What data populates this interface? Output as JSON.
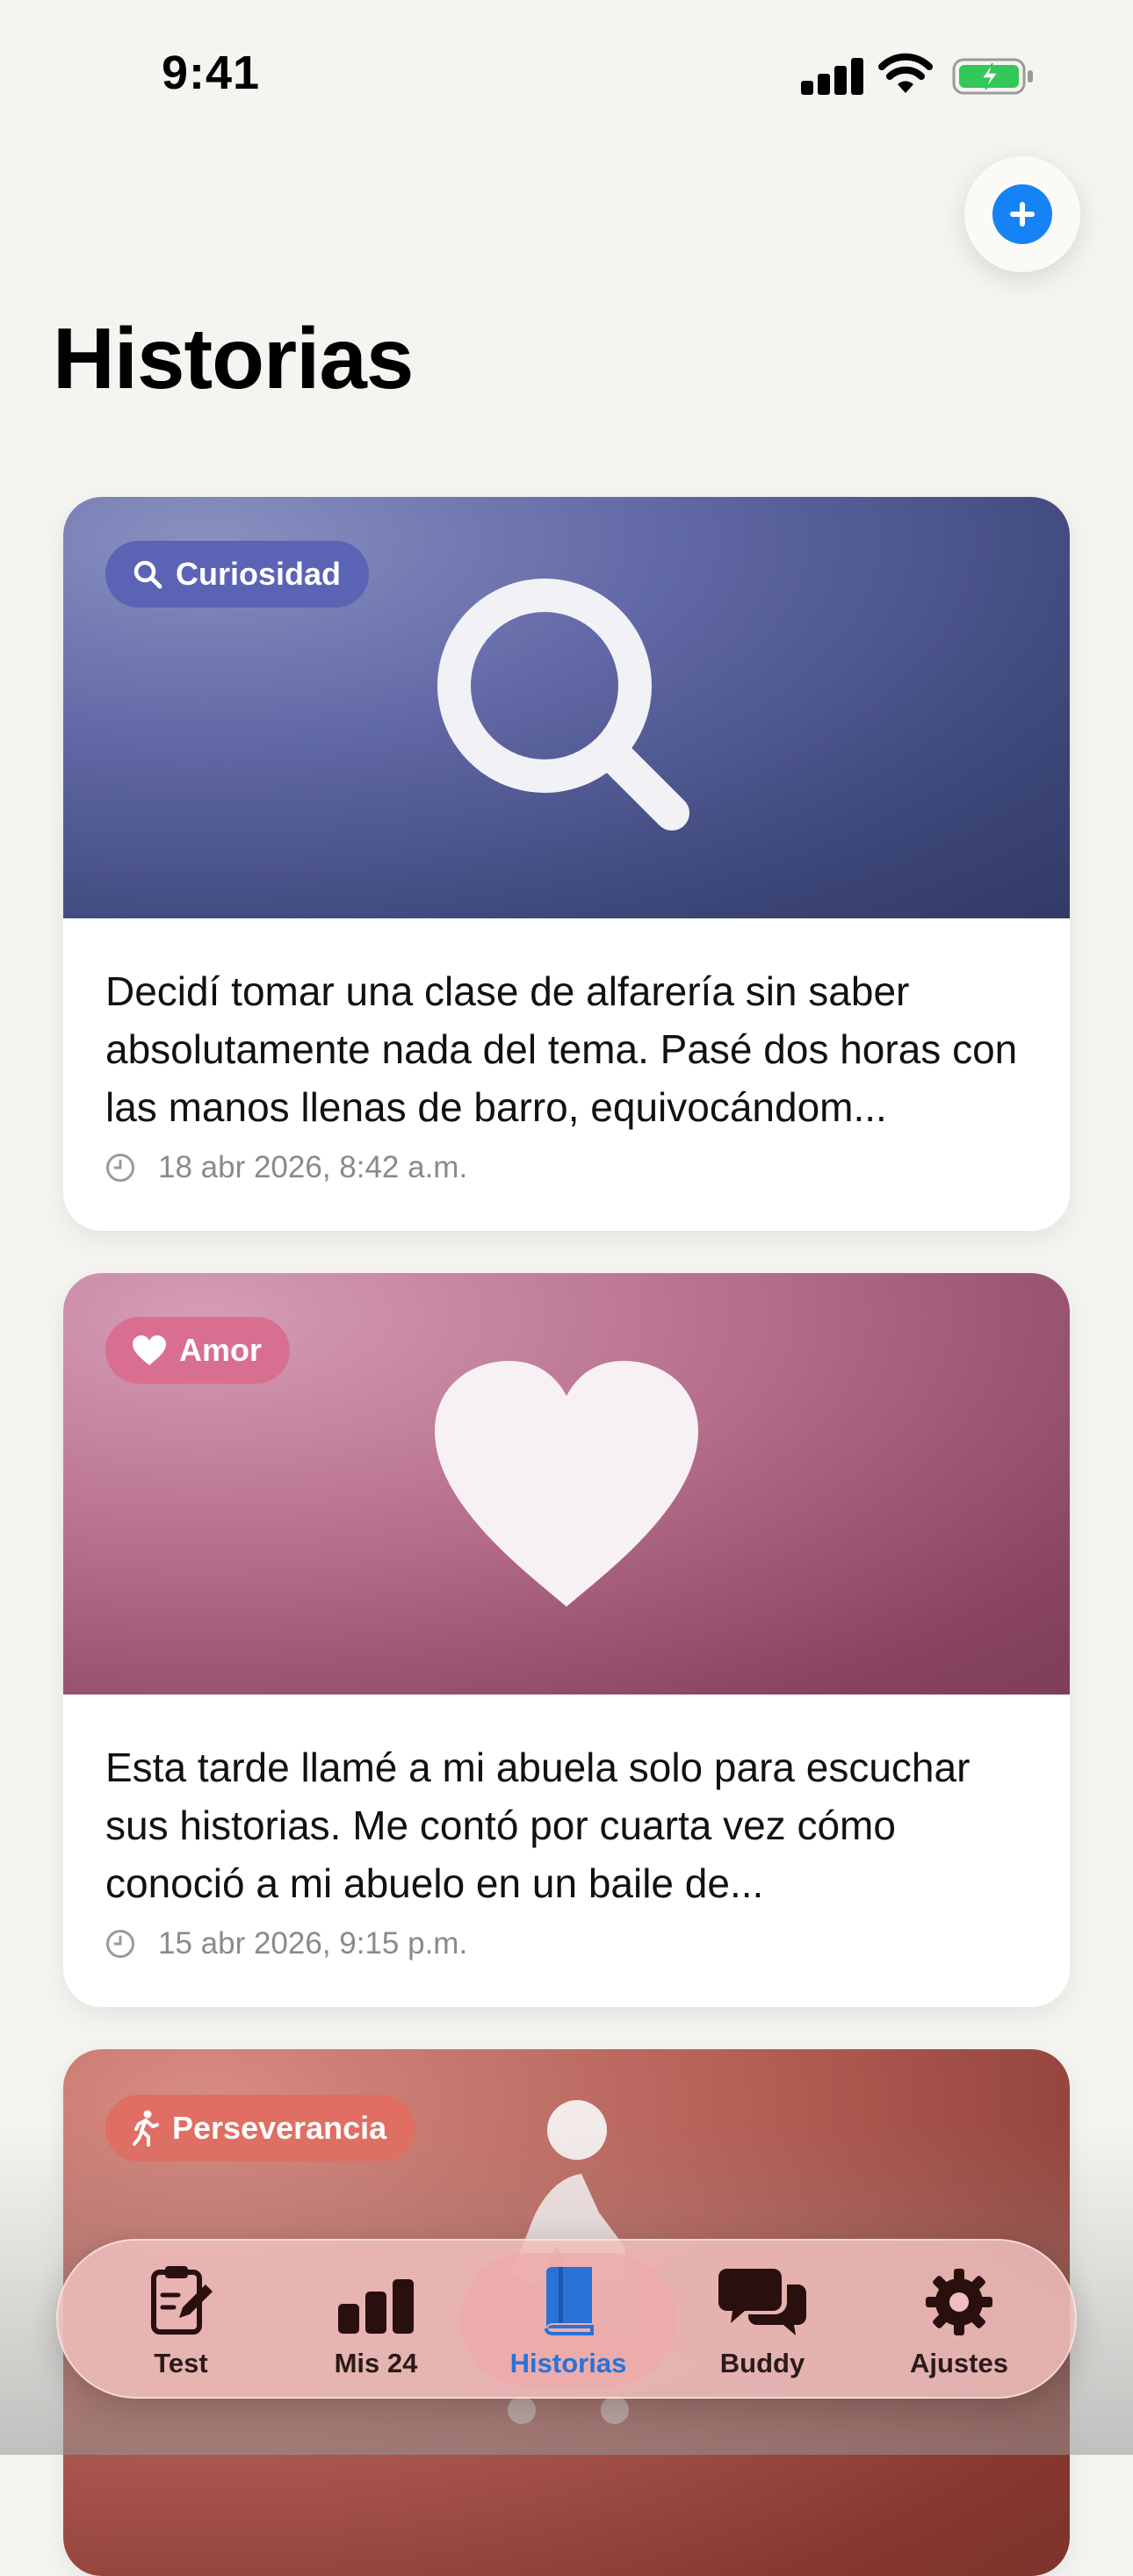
{
  "status_bar": {
    "time": "9:41"
  },
  "header": {
    "title": "Historias"
  },
  "colors": {
    "accent": "#1583f6",
    "tab_active": "#2a72d6"
  },
  "stories": [
    {
      "category": "Curiosidad",
      "category_icon": "search-icon",
      "text": "Decidí tomar una clase de alfarería sin saber absolutamente nada del tema. Pasé dos horas con las manos llenas de barro, equivocándom...",
      "date": "18 abr 2026, 8:42 a.m.",
      "theme_color": "#5a63b4"
    },
    {
      "category": "Amor",
      "category_icon": "heart-icon",
      "text": "Esta tarde llamé a mi abuela solo para escuchar sus historias. Me contó por cuarta vez cómo conoció a mi abuelo en un baile de...",
      "date": "15 abr 2026, 9:15 p.m.",
      "theme_color": "#d96f90"
    },
    {
      "category": "Perseverancia",
      "category_icon": "walking-figure-icon",
      "theme_color": "#e06e62"
    }
  ],
  "tab_bar": {
    "active": "Historias",
    "tabs": [
      {
        "label": "Test",
        "icon": "clipboard-edit-icon"
      },
      {
        "label": "Mis 24",
        "icon": "bar-chart-icon"
      },
      {
        "label": "Historias",
        "icon": "book-icon"
      },
      {
        "label": "Buddy",
        "icon": "chat-bubbles-icon"
      },
      {
        "label": "Ajustes",
        "icon": "gear-icon"
      }
    ]
  }
}
